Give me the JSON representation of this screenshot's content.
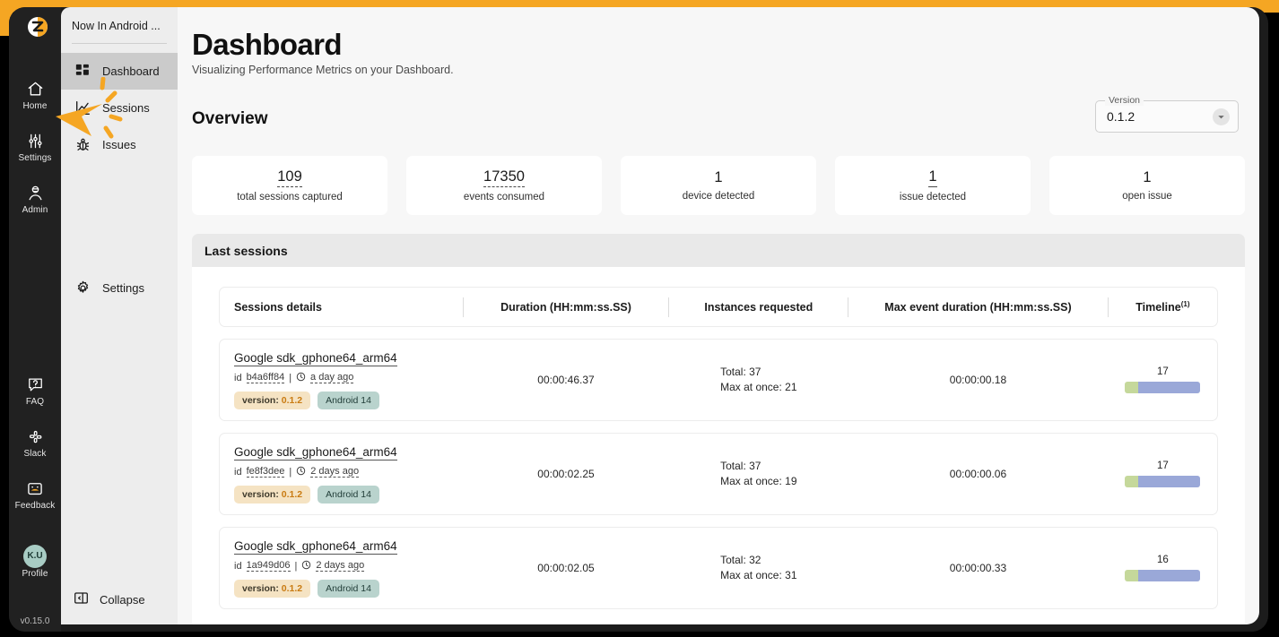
{
  "app": {
    "logo": "zebra-logo-icon",
    "version": "v0.15.0"
  },
  "rail": {
    "items": [
      {
        "label": "Home",
        "icon": "home-icon"
      },
      {
        "label": "Settings",
        "icon": "sliders-icon"
      },
      {
        "label": "Admin",
        "icon": "admin-user-icon"
      },
      {
        "label": "FAQ",
        "icon": "question-bubble-icon"
      },
      {
        "label": "Slack",
        "icon": "slack-icon"
      },
      {
        "label": "Feedback",
        "icon": "feedback-icon"
      }
    ],
    "profile": {
      "label": "Profile",
      "initials": "K.U"
    }
  },
  "drawer": {
    "project": "Now In Android ...",
    "items": [
      {
        "label": "Dashboard",
        "icon": "dashboard-grid-icon",
        "active": true
      },
      {
        "label": "Sessions",
        "icon": "chart-line-icon",
        "active": false
      },
      {
        "label": "Issues",
        "icon": "bug-icon",
        "active": false
      }
    ],
    "settings": {
      "label": "Settings",
      "icon": "gear-icon"
    },
    "collapse": {
      "label": "Collapse",
      "icon": "collapse-panel-icon"
    }
  },
  "header": {
    "title": "Dashboard",
    "subtitle": "Visualizing Performance Metrics on your Dashboard.",
    "overview_title": "Overview"
  },
  "version_select": {
    "legend": "Version",
    "value": "0.1.2",
    "caret_icon": "chevron-down-icon"
  },
  "stats": [
    {
      "value": "109",
      "label": "total sessions captured",
      "style": "dotted"
    },
    {
      "value": "17350",
      "label": "events consumed",
      "style": "dotted"
    },
    {
      "value": "1",
      "label": "device detected",
      "style": "plain"
    },
    {
      "value": "1",
      "label": "issue detected",
      "style": "solid"
    },
    {
      "value": "1",
      "label": "open issue",
      "style": "plain"
    }
  ],
  "sessions_panel": {
    "title": "Last sessions",
    "columns": {
      "details": "Sessions details",
      "duration": "Duration (HH:mm:ss.SS)",
      "instances": "Instances requested",
      "max_event": "Max event duration (HH:mm:ss.SS)",
      "timeline": "Timeline",
      "timeline_sup": "(1)"
    },
    "rows": [
      {
        "name": "Google sdk_gphone64_arm64",
        "id_label": "id",
        "id": "b4a6ff84",
        "separator": "|",
        "clock_icon": "clock-icon",
        "time_ago": "a day ago",
        "badge_version_label": "version:",
        "badge_version_value": "0.1.2",
        "badge_os": "Android 14",
        "duration": "00:00:46.37",
        "instances_total": "Total: 37",
        "instances_max": "Max at once: 21",
        "max_event_duration": "00:00:00.18",
        "timeline_count": "17",
        "timeline_seg_a_pct": 18,
        "timeline_seg_b_pct": 82
      },
      {
        "name": "Google sdk_gphone64_arm64",
        "id_label": "id",
        "id": "fe8f3dee",
        "separator": "|",
        "clock_icon": "clock-icon",
        "time_ago": "2 days ago",
        "badge_version_label": "version:",
        "badge_version_value": "0.1.2",
        "badge_os": "Android 14",
        "duration": "00:00:02.25",
        "instances_total": "Total: 37",
        "instances_max": "Max at once: 19",
        "max_event_duration": "00:00:00.06",
        "timeline_count": "17",
        "timeline_seg_a_pct": 18,
        "timeline_seg_b_pct": 82
      },
      {
        "name": "Google sdk_gphone64_arm64",
        "id_label": "id",
        "id": "1a949d06",
        "separator": "|",
        "clock_icon": "clock-icon",
        "time_ago": "2 days ago",
        "badge_version_label": "version:",
        "badge_version_value": "0.1.2",
        "badge_os": "Android 14",
        "duration": "00:00:02.05",
        "instances_total": "Total: 32",
        "instances_max": "Max at once: 31",
        "max_event_duration": "00:00:00.33",
        "timeline_count": "16",
        "timeline_seg_a_pct": 18,
        "timeline_seg_b_pct": 82
      }
    ]
  },
  "colors": {
    "frame_accent": "#f5a623",
    "rail_bg": "#212121",
    "drawer_bg": "#ededed",
    "active_nav": "#cbcbcb",
    "content_bg": "#f7f7f7",
    "timeline_green": "#c5d89b",
    "timeline_blue": "#9aa8d8",
    "badge_version_bg": "#f5e3c3",
    "badge_version_fg": "#c97b12",
    "badge_os_bg": "#b9d3cd",
    "avatar_bg": "#a8ccc4"
  },
  "cursor": {
    "icon": "mouse-pointer-click-icon"
  }
}
